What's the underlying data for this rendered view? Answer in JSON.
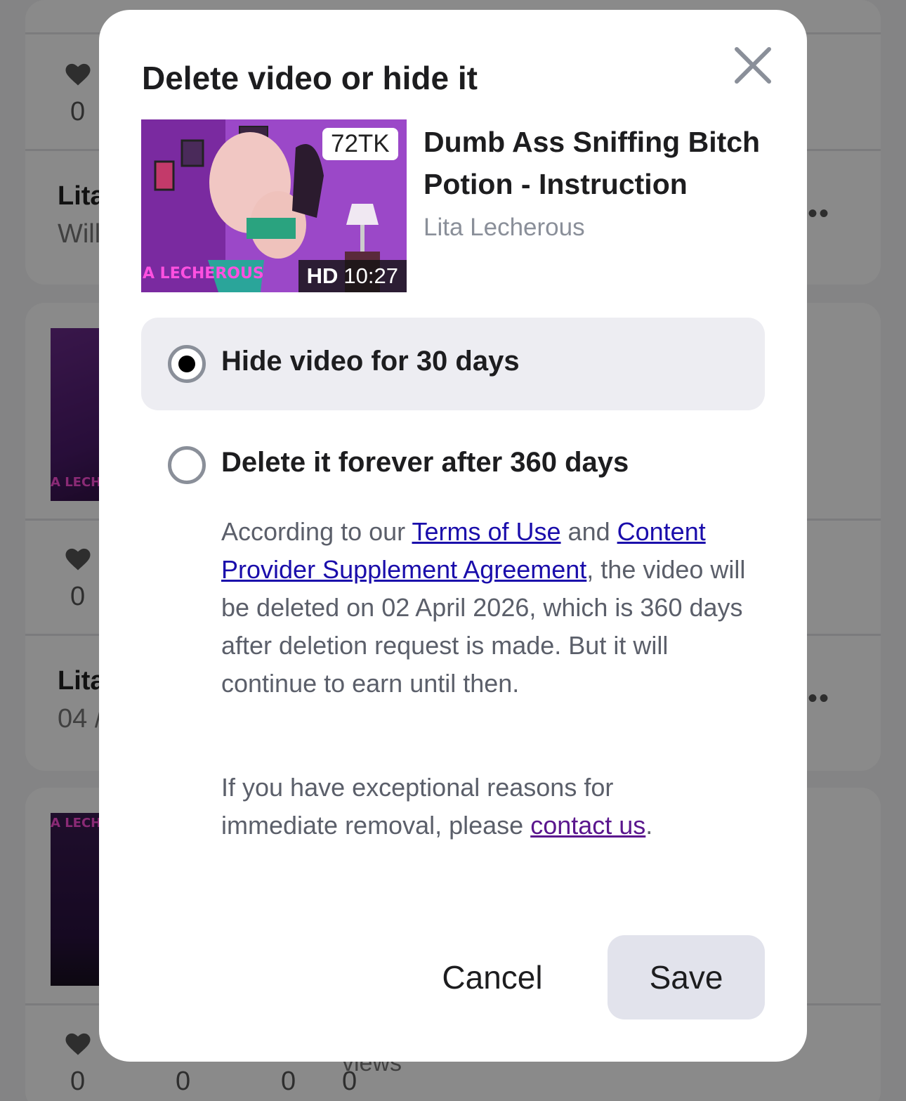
{
  "background": {
    "top_like_count": "0",
    "row1_name": "Lita",
    "row1_sub": "Will",
    "row2_like_count": "0",
    "row2_name": "Lita",
    "row2_sub": "04 /",
    "bottom_counts": [
      "0",
      "0",
      "0",
      "0"
    ],
    "bottom_views_label": "views",
    "thumb_watermark": "A LECHERO",
    "more_icon": "more-dots-icon",
    "heart_icon": "heart-icon"
  },
  "modal": {
    "title": "Delete video or hide it",
    "close_icon": "close-icon",
    "video": {
      "badge": "72TK",
      "quality": "HD",
      "duration": "10:27",
      "watermark": "A LECHEROUS",
      "title": "Dumb Ass Sniffing Bitch Potion - Instruction",
      "author": "Lita Lecherous"
    },
    "options": [
      {
        "label": "Hide video for 30 days",
        "selected": true
      },
      {
        "label": "Delete it forever after 360 days",
        "selected": false
      }
    ],
    "terms": {
      "prefix": "According to our ",
      "terms_link": "Terms of Use",
      "middle": " and ",
      "agreement_link": "Content Provider Supplement Agreement",
      "suffix": ", the video will be deleted on 02 April 2026, which is 360 days after deletion request is made. But it will continue to earn until then."
    },
    "contact": {
      "prefix": "If you have exceptional reasons for immediate removal, please ",
      "link": "contact us",
      "suffix": "."
    },
    "cancel_label": "Cancel",
    "save_label": "Save"
  }
}
